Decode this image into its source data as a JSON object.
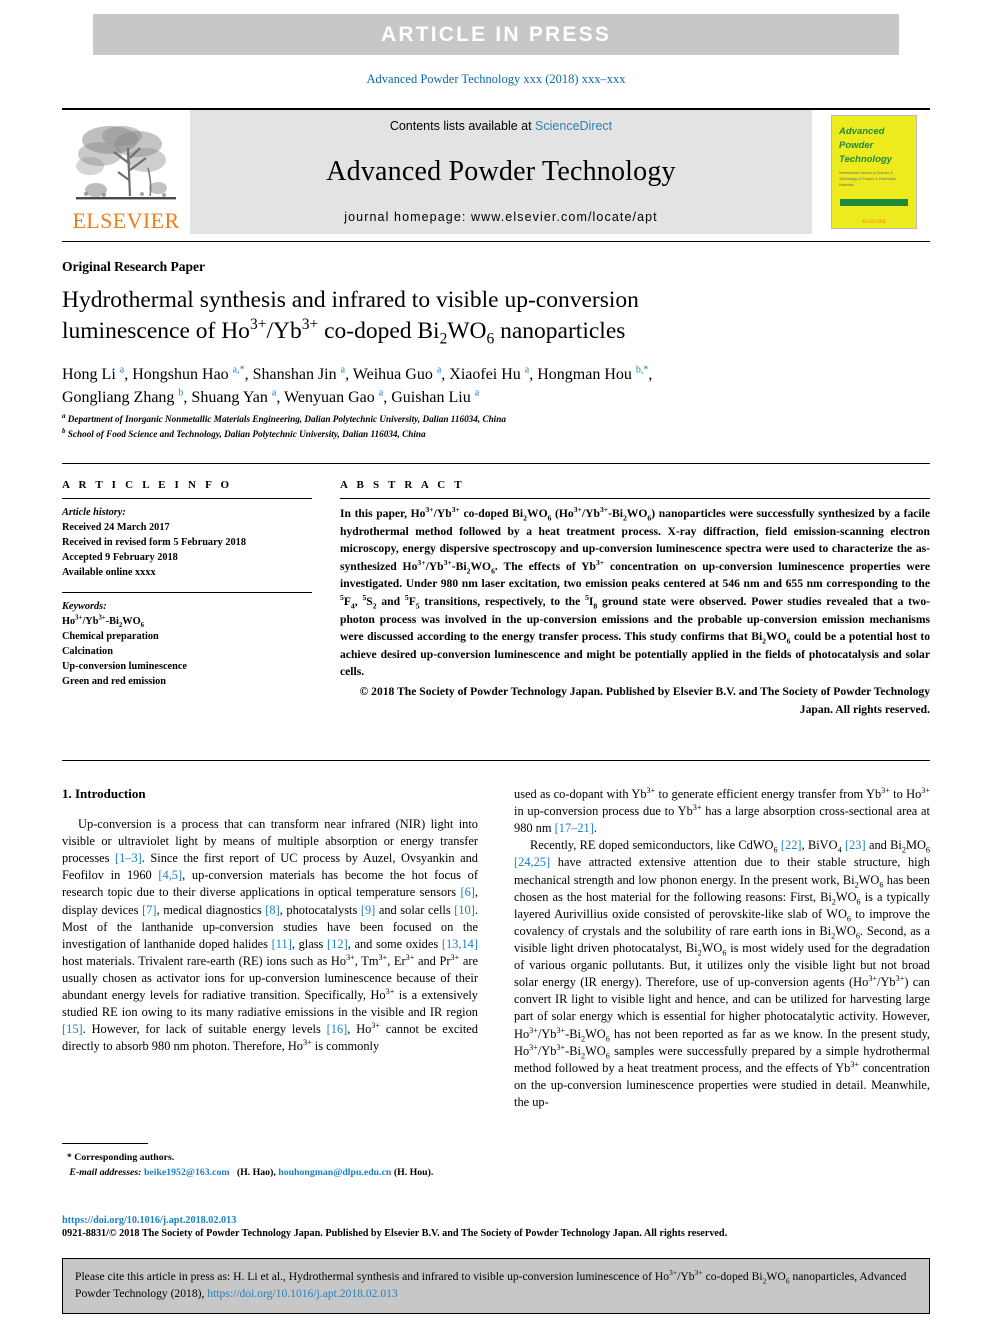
{
  "banner": {
    "text": "ARTICLE  IN  PRESS"
  },
  "running_head": "Advanced Powder Technology xxx (2018) xxx–xxx",
  "masthead": {
    "contents_prefix": "Contents lists available at ",
    "contents_link": "ScienceDirect",
    "journal_name": "Advanced Powder Technology",
    "homepage": "journal homepage: www.elsevier.com/locate/apt",
    "publisher": "ELSEVIER",
    "cover": {
      "line1": "Advanced",
      "line2": "Powder",
      "line3": "Technology",
      "subtitle": "International Journal of Science & Technology of Powder & Particulate Materials",
      "footer": "ELSEVIER"
    }
  },
  "article": {
    "type": "Original Research Paper",
    "title_line1": "Hydrothermal synthesis and infrared to visible up-conversion",
    "title_line2_pre": "luminescence of Ho",
    "title_line2_mid": "/Yb",
    "title_line2_post": " co-doped Bi",
    "title_line2_end": "WO",
    "title_line2_tail": " nanoparticles",
    "authors": "Hong Li a, Hongshun Hao a,*, Shanshan Jin a, Weihua Guo a, Xiaofei Hu a, Hongman Hou b,*, Gongliang Zhang b, Shuang Yan a, Wenyuan Gao a, Guishan Liu a",
    "affiliation_a": "Department of Inorganic Nonmetallic Materials Engineering, Dalian Polytechnic University, Dalian 116034, China",
    "affiliation_b": "School of Food Science and Technology, Dalian Polytechnic University, Dalian 116034, China"
  },
  "article_info": {
    "heading": "A R T I C L E   I N F O",
    "history_label": "Article history:",
    "history": [
      "Received 24 March 2017",
      "Received in revised form 5 February 2018",
      "Accepted 9 February 2018",
      "Available online xxxx"
    ],
    "keywords_label": "Keywords:",
    "keywords": [
      "Ho3+/Yb3+-Bi2WO6",
      "Chemical preparation",
      "Calcination",
      "Up-conversion luminescence",
      "Green and red emission"
    ]
  },
  "abstract": {
    "heading": "A B S T R A C T",
    "body": "In this paper, Ho3+/Yb3+ co-doped Bi2WO6 (Ho3+/Yb3+-Bi2WO6) nanoparticles were successfully synthesized by a facile hydrothermal method followed by a heat treatment process. X-ray diffraction, field emission-scanning electron microscopy, energy dispersive spectroscopy and up-conversion luminescence spectra were used to characterize the as-synthesized Ho3+/Yb3+-Bi2WO6. The effects of Yb3+ concentration on up-conversion luminescence properties were investigated. Under 980 nm laser excitation, two emission peaks centered at 546 nm and 655 nm corresponding to the 5F4, 5S2 and 5F5 transitions, respectively, to the 5I8 ground state were observed. Power studies revealed that a two-photon process was involved in the up-conversion emissions and the probable up-conversion emission mechanisms were discussed according to the energy transfer process. This study confirms that Bi2WO6 could be a potential host to achieve desired up-conversion luminescence and might be potentially applied in the fields of photocatalysis and solar cells.",
    "copyright": "© 2018 The Society of Powder Technology Japan. Published by Elsevier B.V. and The Society of Powder Technology Japan. All rights reserved."
  },
  "introduction": {
    "heading": "1. Introduction",
    "para1": "Up-conversion is a process that can transform near infrared (NIR) light into visible or ultraviolet light by means of multiple absorption or energy transfer processes [1–3]. Since the first report of UC process by Auzel, Ovsyankin and Feofilov in 1960 [4,5], up-conversion materials has become the hot focus of research topic due to their diverse applications in optical temperature sensors [6], display devices [7], medical diagnostics [8], photocatalysts [9] and solar cells [10]. Most of the lanthanide up-conversion studies have been focused on the investigation of lanthanide doped halides [11], glass [12], and some oxides [13,14] host materials. Trivalent rare-earth (RE) ions such as Ho3+, Tm3+, Er3+ and Pr3+ are usually chosen as activator ions for up-conversion luminescence because of their abundant energy levels for radiative transition. Specifically, Ho3+ is a extensively studied RE ion owing to its many radiative emissions in the visible and IR region [15]. However, for lack of suitable energy levels [16], Ho3+ cannot be excited directly to absorb 980 nm photon. Therefore, Ho3+ is commonly used as co-dopant with Yb3+ to generate efficient energy transfer from Yb3+ to Ho3+ in up-conversion process due to Yb3+ has a large absorption cross-sectional area at 980 nm [17–21].",
    "para2": "Recently, RE doped semiconductors, like CdWO6 [22], BiVO4 [23] and Bi2MO6 [24,25] have attracted extensive attention due to their stable structure, high mechanical strength and low phonon energy. In the present work, Bi2WO6 has been chosen as the host material for the following reasons: First, Bi2WO6 is a typically layered Aurivillius oxide consisted of perovskite-like slab of WO6 to improve the covalency of crystals and the solubility of rare earth ions in Bi2WO6. Second, as a visible light driven photocatalyst, Bi2WO6 is most widely used for the degradation of various organic pollutants. But, it utilizes only the visible light but not broad solar energy (IR energy). Therefore, use of up-conversion agents (Ho3+/Yb3+) can convert IR light to visible light and hence, and can be utilized for harvesting large part of solar energy which is essential for higher photocatalytic activity. However, Ho3+/Yb3+-Bi2WO6 has not been reported as far as we know. In the present study, Ho3+/Yb3+-Bi2WO6 samples were successfully prepared by a simple hydrothermal method followed by a heat treatment process, and the effects of Yb3+ concentration on the up-conversion luminescence properties were studied in detail. Meanwhile, the up-"
  },
  "footnote": {
    "star": "*",
    "corresponding": "Corresponding authors.",
    "email_label": "E-mail addresses:",
    "email1": "beike1952@163.com",
    "email1_who": "(H. Hao),",
    "email2": "houhongman@dlpu.edu.cn",
    "email2_who": "(H. Hou)."
  },
  "bottom": {
    "doi": "https://doi.org/10.1016/j.apt.2018.02.013",
    "issn_line": "0921-8831/© 2018 The Society of Powder Technology Japan. Published by Elsevier B.V. and The Society of Powder Technology Japan. All rights reserved."
  },
  "cite_box": {
    "prefix": "Please cite this article in press as: H. Li et al., Hydrothermal synthesis and infrared to visible up-conversion luminescence of Ho",
    "mid1": "/Yb",
    "mid2": " co-doped Bi",
    "mid3": "WO",
    "suffix": " nanoparticles, Advanced Powder Technology (2018), ",
    "link": "https://doi.org/10.1016/j.apt.2018.02.013"
  },
  "colors": {
    "banner_bg": "#c7c7c7",
    "link_blue": "#1b7fc4",
    "elsevier_orange": "#ef7d1a",
    "cover_yellow": "#edea1e",
    "cover_green": "#1f8a3b",
    "masthead_gray": "#e3e3e3"
  }
}
